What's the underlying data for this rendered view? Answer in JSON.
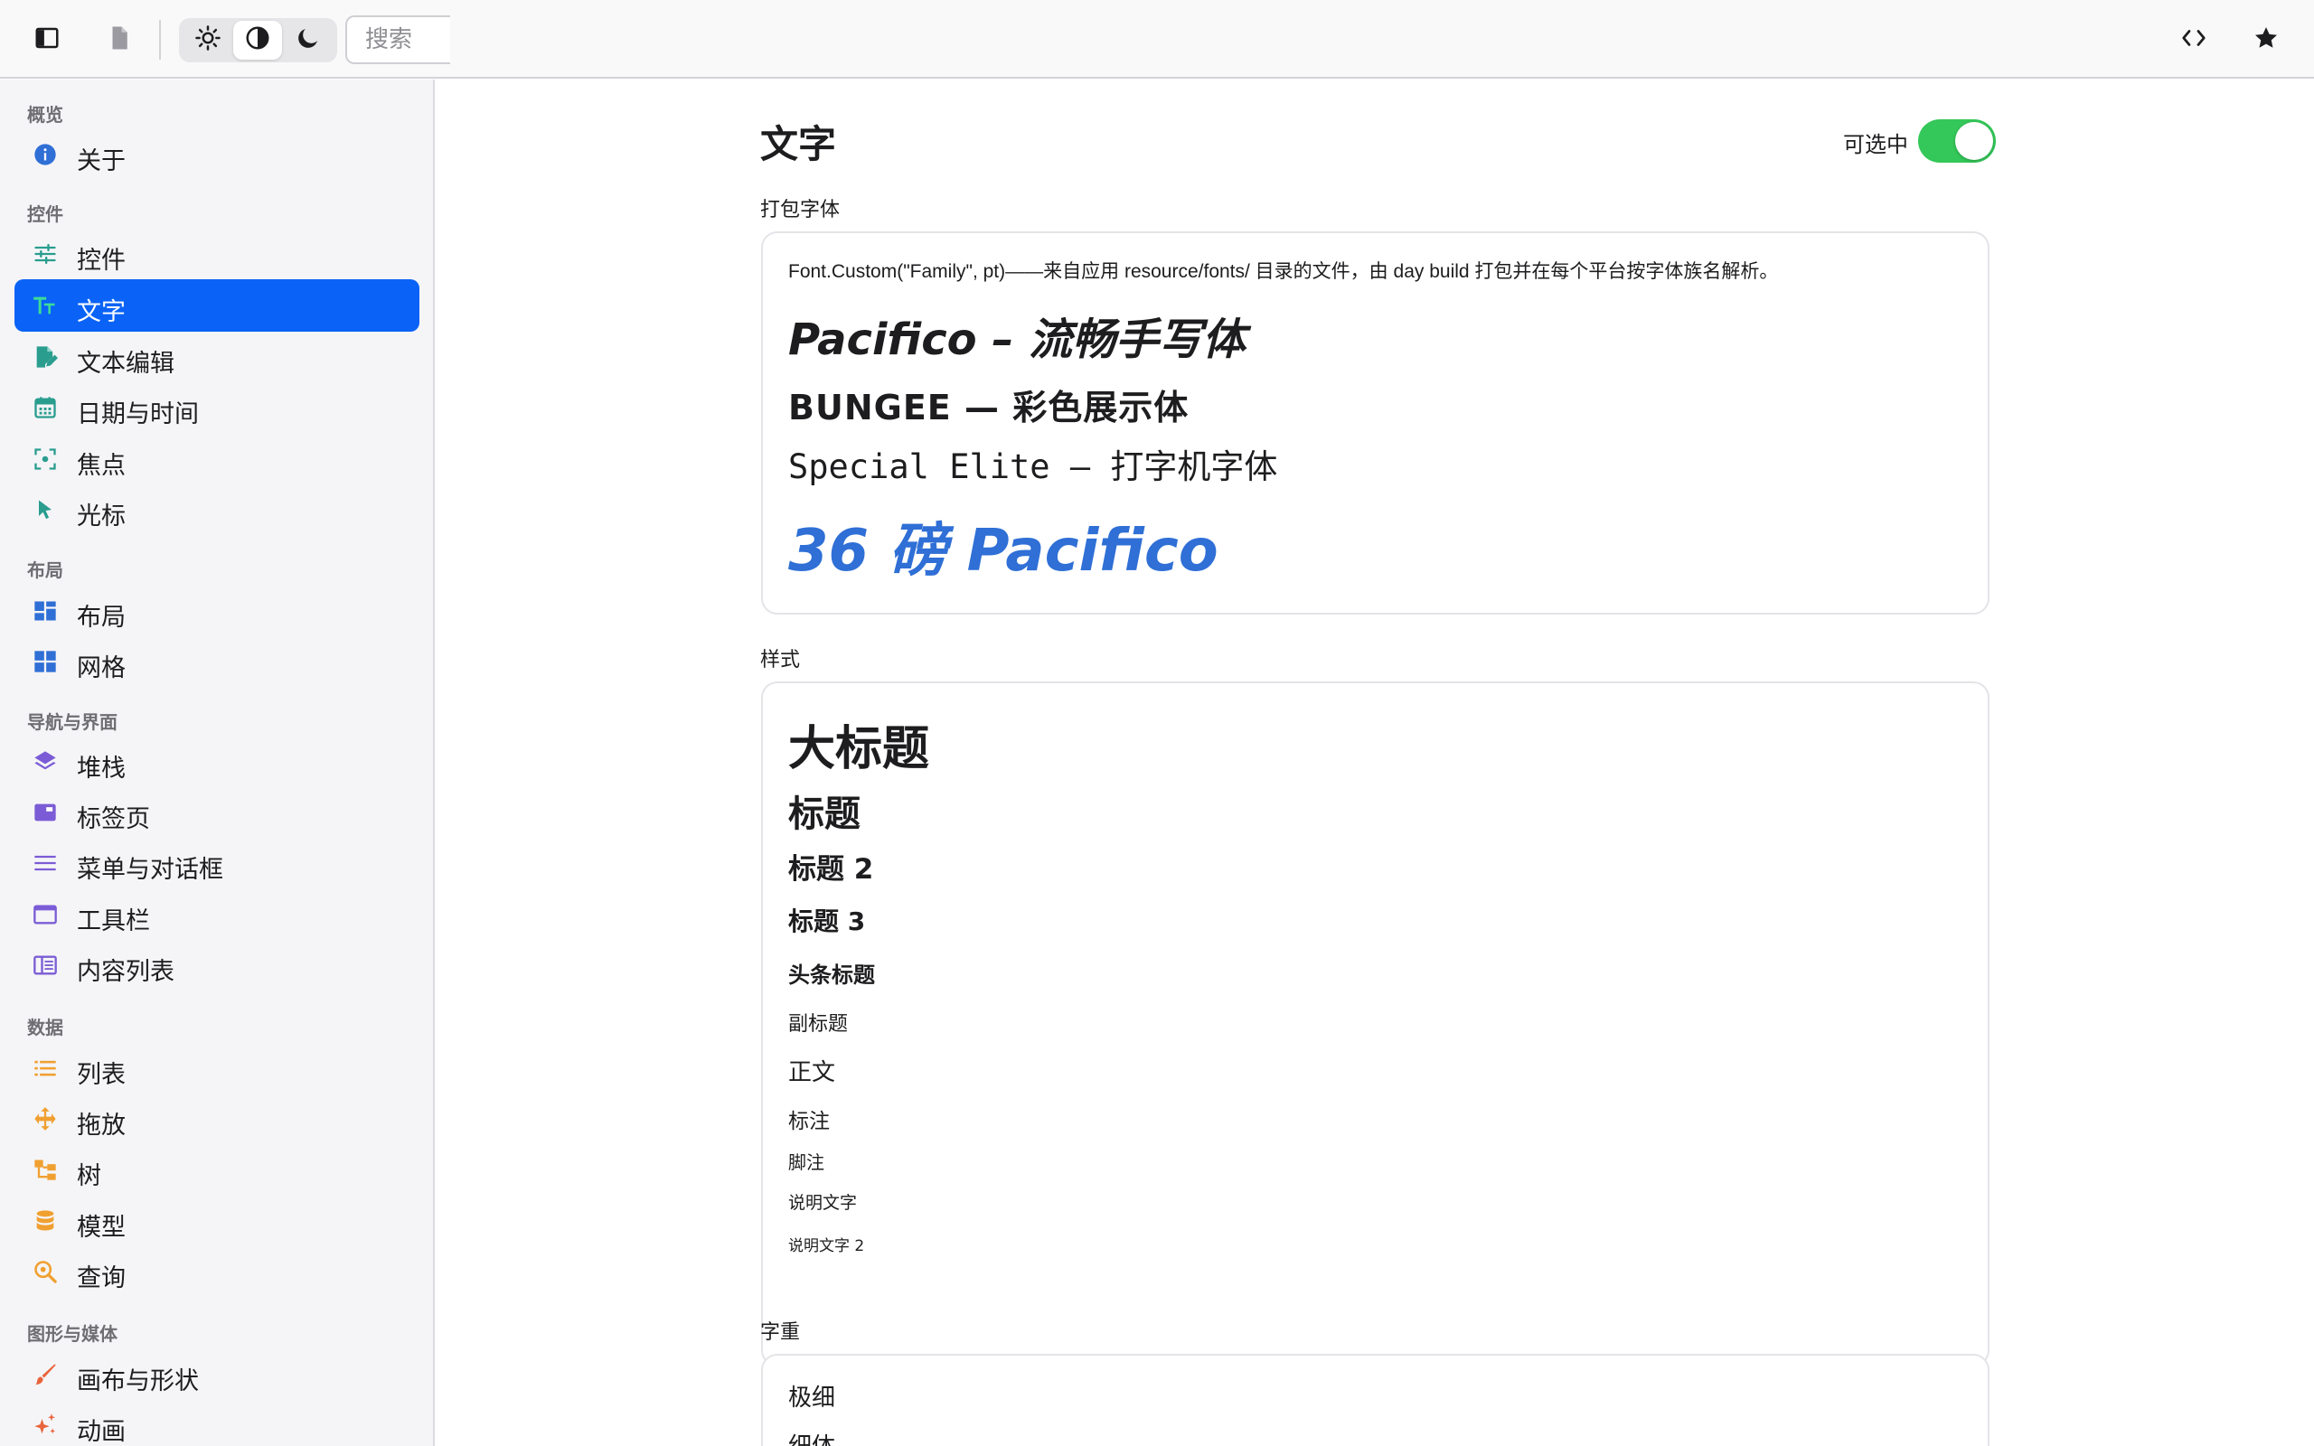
{
  "toolbar": {
    "search_placeholder": "搜索",
    "icons": [
      "sidebar-toggle-icon",
      "document-icon",
      "sun-icon",
      "contrast-icon",
      "moon-icon",
      "code-icon",
      "star-icon"
    ]
  },
  "sidebar": {
    "sections": [
      {
        "title": "概览",
        "items": [
          {
            "label": "关于",
            "icon": "info-icon",
            "color": "#2f6fd6"
          }
        ]
      },
      {
        "title": "控件",
        "items": [
          {
            "label": "控件",
            "icon": "sliders-icon",
            "color": "#2a9d8f"
          },
          {
            "label": "文字",
            "icon": "text-size-icon",
            "color": "#3ddc97",
            "active": true
          },
          {
            "label": "文本编辑",
            "icon": "edit-document-icon",
            "color": "#2a9d8f"
          },
          {
            "label": "日期与时间",
            "icon": "calendar-icon",
            "color": "#2a9d8f"
          },
          {
            "label": "焦点",
            "icon": "focus-icon",
            "color": "#2a9d8f"
          },
          {
            "label": "光标",
            "icon": "cursor-icon",
            "color": "#2a9d8f"
          }
        ]
      },
      {
        "title": "布局",
        "items": [
          {
            "label": "布局",
            "icon": "layout-icon",
            "color": "#2f6fd6"
          },
          {
            "label": "网格",
            "icon": "grid-icon",
            "color": "#2f6fd6"
          }
        ]
      },
      {
        "title": "导航与界面",
        "items": [
          {
            "label": "堆栈",
            "icon": "layers-icon",
            "color": "#7b5cd6"
          },
          {
            "label": "标签页",
            "icon": "tabs-icon",
            "color": "#7b5cd6"
          },
          {
            "label": "菜单与对话框",
            "icon": "menu-icon",
            "color": "#7b5cd6"
          },
          {
            "label": "工具栏",
            "icon": "window-icon",
            "color": "#7b5cd6"
          },
          {
            "label": "内容列表",
            "icon": "columns-icon",
            "color": "#7b5cd6"
          }
        ]
      },
      {
        "title": "数据",
        "items": [
          {
            "label": "列表",
            "icon": "list-icon",
            "color": "#f0a030"
          },
          {
            "label": "拖放",
            "icon": "move-icon",
            "color": "#f0a030"
          },
          {
            "label": "树",
            "icon": "tree-icon",
            "color": "#f0a030"
          },
          {
            "label": "模型",
            "icon": "database-icon",
            "color": "#f0a030"
          },
          {
            "label": "查询",
            "icon": "search-zoom-icon",
            "color": "#f0a030"
          }
        ]
      },
      {
        "title": "图形与媒体",
        "items": [
          {
            "label": "画布与形状",
            "icon": "brush-icon",
            "color": "#e8643c"
          },
          {
            "label": "动画",
            "icon": "sparkles-icon",
            "color": "#e8643c"
          }
        ]
      }
    ]
  },
  "main": {
    "title": "文字",
    "selectable_label": "可选中",
    "selectable_on": true,
    "bundled": {
      "label": "打包字体",
      "description": "Font.Custom(\"Family\", pt)——来自应用 resource/fonts/ 目录的文件，由 day build 打包并在每个平台按字体族名解析。",
      "line1": "Pacifico – 流畅手写体",
      "line2": "BUNGEE — 彩色展示体",
      "line3": "Special Elite — 打字机字体",
      "line4": "36 磅 Pacifico",
      "accent": "#2f6fd6"
    },
    "styles": {
      "label": "样式",
      "items": [
        "大标题",
        "标题",
        "标题 2",
        "标题 3",
        "头条标题",
        "副标题",
        "正文",
        "标注",
        "脚注",
        "说明文字",
        "说明文字 2"
      ]
    },
    "weights": {
      "label": "字重",
      "items": [
        "极细",
        "细体"
      ]
    }
  }
}
